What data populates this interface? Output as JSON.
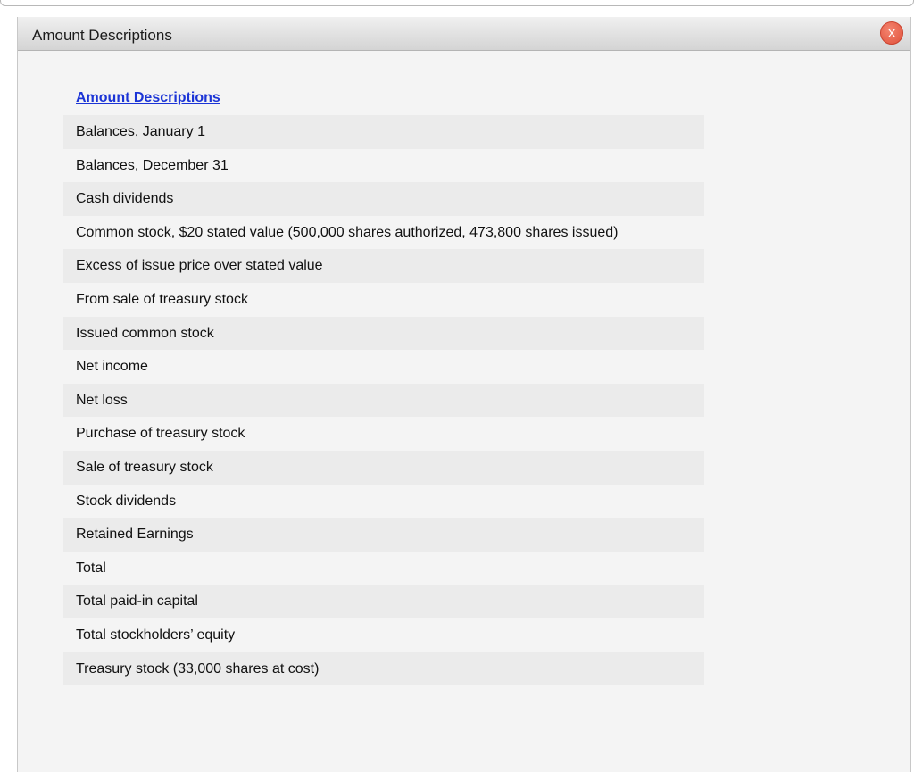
{
  "dialog": {
    "title": "Amount Descriptions",
    "close_label": "X"
  },
  "section": {
    "heading": "Amount Descriptions"
  },
  "items": [
    "Balances, January 1",
    "Balances, December 31",
    "Cash dividends",
    "Common stock, $20 stated value (500,000 shares authorized, 473,800 shares issued)",
    "Excess of issue price over stated value",
    "From sale of treasury stock",
    "Issued common stock",
    "Net income",
    "Net loss",
    "Purchase of treasury stock",
    "Sale of treasury stock",
    "Stock dividends",
    "Retained Earnings",
    "Total",
    "Total paid-in capital",
    "Total stockholders’ equity",
    "Treasury stock (33,000 shares at cost)"
  ],
  "colors": {
    "link": "#1b34d6",
    "close_button": "#e0513b",
    "row_alt": "#ebebeb",
    "background": "#f4f4f4"
  }
}
